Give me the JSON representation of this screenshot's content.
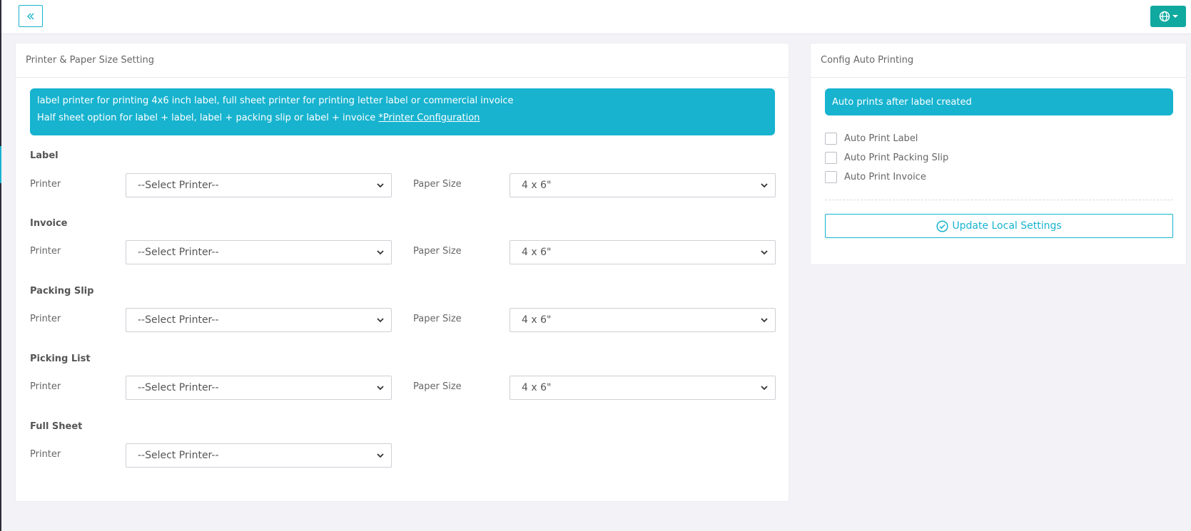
{
  "printer_section": {
    "title": "Printer & Paper Size Setting",
    "info_line1": "label printer for printing 4x6 inch label, full sheet printer for printing letter label or commercial invoice",
    "info_line2": "Half sheet option for label + label, label + packing slip or label + invoice ",
    "info_link": "*Printer Configuration",
    "printer_label": "Printer",
    "paper_label": "Paper Size",
    "groups": [
      {
        "title": "Label",
        "printer": "--Select Printer--",
        "paper": "4 x 6\""
      },
      {
        "title": "Invoice",
        "printer": "--Select Printer--",
        "paper": "4 x 6\""
      },
      {
        "title": "Packing Slip",
        "printer": "--Select Printer--",
        "paper": "4 x 6\""
      },
      {
        "title": "Picking List",
        "printer": "--Select Printer--",
        "paper": "4 x 6\""
      },
      {
        "title": "Full Sheet",
        "printer": "--Select Printer--"
      }
    ]
  },
  "auto_section": {
    "title": "Config Auto Printing",
    "info": "Auto prints after label created",
    "options": [
      "Auto Print Label",
      "Auto Print Packing Slip",
      "Auto Print Invoice"
    ],
    "update_label": "Update Local Settings"
  },
  "colors": {
    "accent": "#17b3cf",
    "lang_button": "#10a9a0",
    "background": "#f3f2f7"
  },
  "icons": {
    "collapse": "double-chevron-left-icon",
    "language": "globe-icon",
    "update": "check-circle-icon"
  }
}
